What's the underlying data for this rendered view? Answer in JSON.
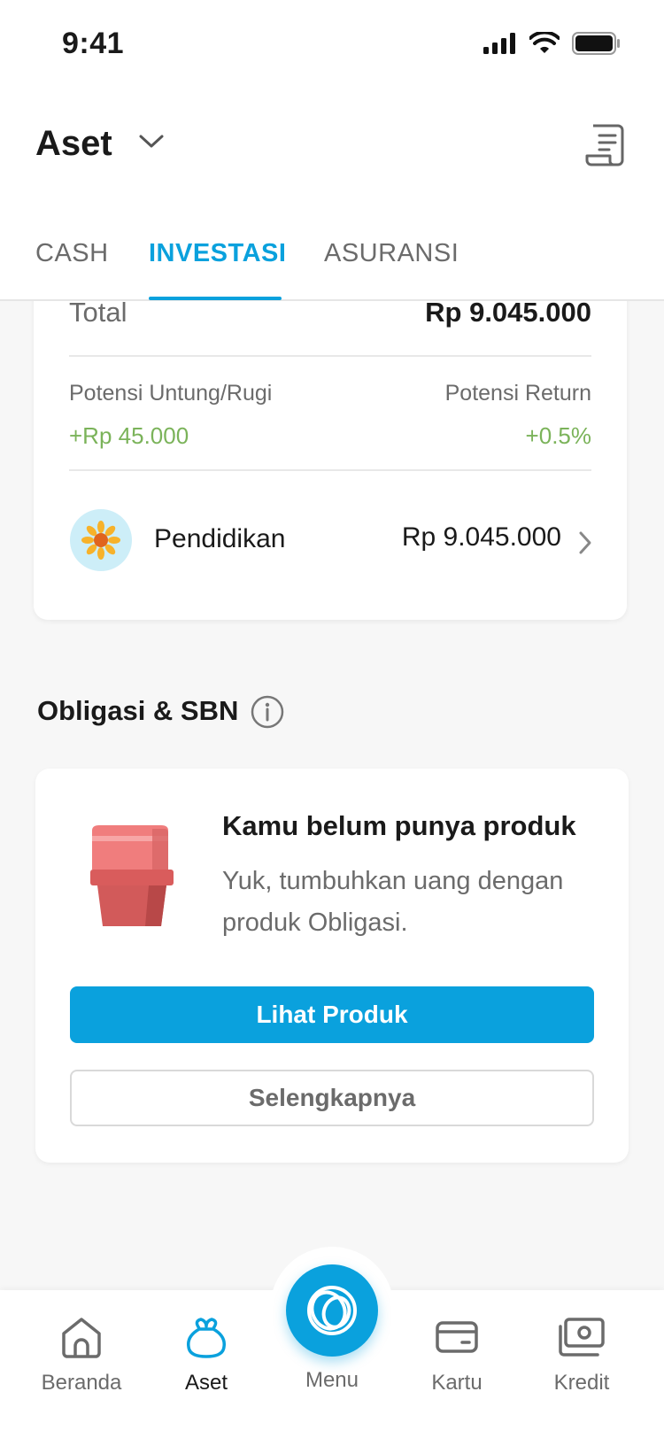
{
  "status_bar": {
    "time": "9:41"
  },
  "header": {
    "title": "Aset"
  },
  "tabs": [
    {
      "label": "CASH",
      "active": false
    },
    {
      "label": "INVESTASI",
      "active": true
    },
    {
      "label": "ASURANSI",
      "active": false
    }
  ],
  "summary": {
    "total_label": "Total",
    "total_value": "Rp 9.045.000",
    "potensi_untung_label": "Potensi Untung/Rugi",
    "potensi_untung_value": "+Rp 45.000",
    "potensi_return_label": "Potensi Return",
    "potensi_return_value": "+0.5%",
    "goal": {
      "label": "Pendidikan",
      "value": "Rp 9.045.000",
      "icon": "sunflower-icon"
    }
  },
  "obligasi": {
    "title": "Obligasi & SBN",
    "empty_title": "Kamu belum punya produk",
    "empty_desc": "Yuk, tumbuhkan uang dengan produk Obligasi.",
    "primary_button": "Lihat Produk",
    "secondary_button": "Selengkapnya"
  },
  "bottom_nav": {
    "items": [
      {
        "label": "Beranda",
        "icon": "home-icon",
        "active": false
      },
      {
        "label": "Aset",
        "icon": "money-bag-icon",
        "active": true
      },
      {
        "label": "Menu",
        "icon": "menu-rings-icon",
        "active": false
      },
      {
        "label": "Kartu",
        "icon": "card-icon",
        "active": false
      },
      {
        "label": "Kredit",
        "icon": "cash-icon",
        "active": false
      }
    ]
  },
  "colors": {
    "accent": "#0aa1dd",
    "positive": "#7bb35a",
    "text_secondary": "#6b6b6b"
  }
}
